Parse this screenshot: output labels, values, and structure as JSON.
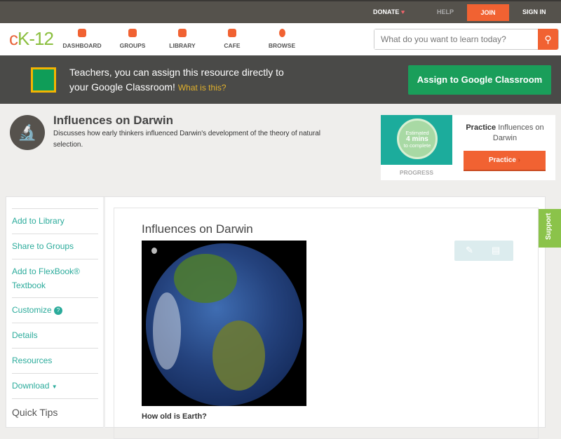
{
  "topbar": {
    "donate": "DONATE",
    "help": "HELP",
    "join": "JOIN",
    "signin": "SIGN IN"
  },
  "nav": {
    "logo_left": "c",
    "logo_right": "K-12",
    "items": [
      {
        "label": "DASHBOARD"
      },
      {
        "label": "GROUPS"
      },
      {
        "label": "LIBRARY"
      },
      {
        "label": "CAFE"
      },
      {
        "label": "BROWSE"
      }
    ],
    "search_placeholder": "What do you want to learn today?"
  },
  "banner": {
    "text": "Teachers, you can assign this resource directly to your Google Classroom!",
    "link": "What is this?",
    "button": "Assign to Google Classroom"
  },
  "header": {
    "title": "Influences on Darwin",
    "description": "Discusses how early thinkers influenced Darwin's development of the theory of natural selection."
  },
  "practice": {
    "estimated": "Estimated",
    "mins": "4 mins",
    "complete": "to complete",
    "progress": "PROGRESS",
    "title_bold": "Practice",
    "title_rest": "Influences on Darwin",
    "button": "Practice"
  },
  "sidebar": {
    "items": [
      "Add to Library",
      "Share to Groups",
      "Add to FlexBook® Textbook",
      "Customize",
      "Details",
      "Resources",
      "Download"
    ],
    "quick_tips": "Quick Tips"
  },
  "main": {
    "title": "Influences on Darwin",
    "question": "How old is Earth?"
  },
  "support": "Support",
  "colors": {
    "accent": "#f16232",
    "green": "#1a9e5a",
    "teal": "#2bab9b"
  }
}
